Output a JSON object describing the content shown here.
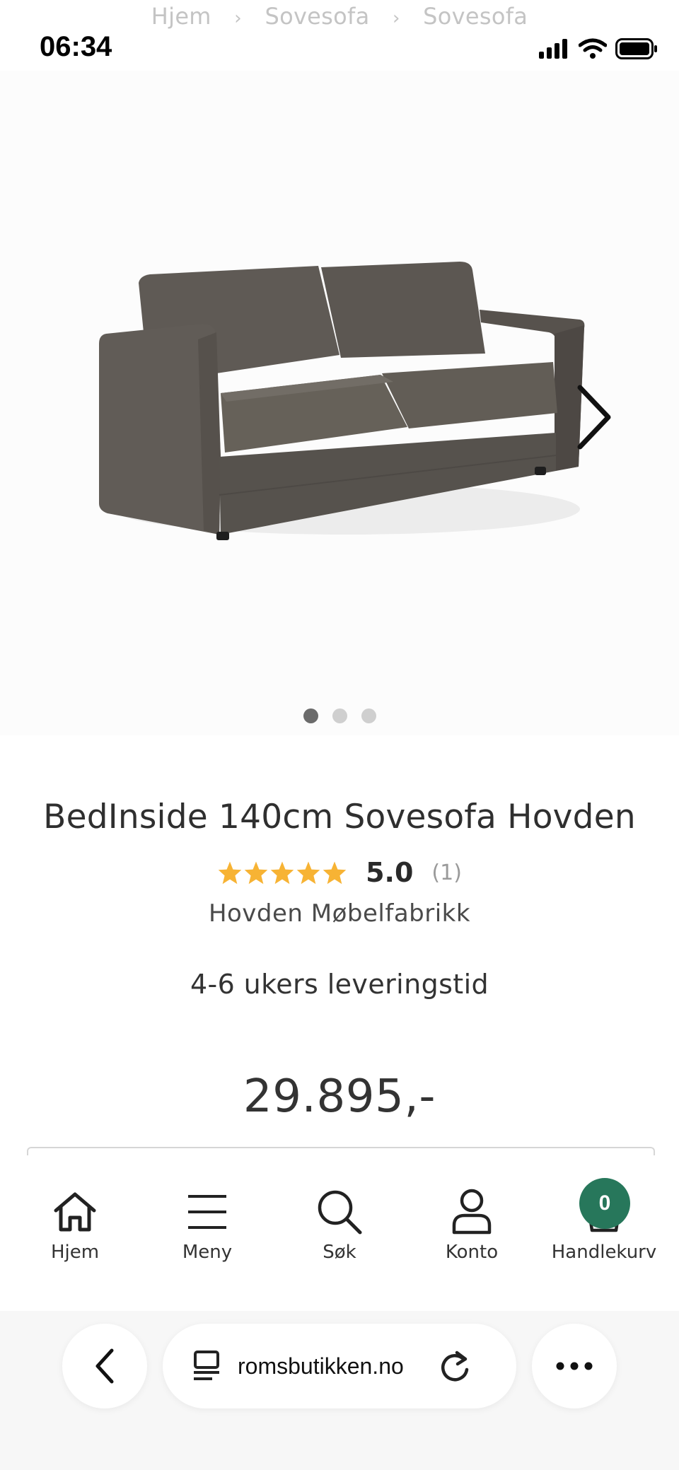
{
  "status_bar": {
    "time": "06:34",
    "icons": [
      "cellular-signal-icon",
      "wifi-icon",
      "battery-icon"
    ]
  },
  "breadcrumb": [
    "Hjem",
    "Sovesofa",
    "Sovesofa"
  ],
  "gallery": {
    "image_count": 3,
    "active_index": 0,
    "next_icon": "chevron-right-icon"
  },
  "product": {
    "title": "BedInside 140cm Sovesofa Hovden",
    "rating": "5.0",
    "rating_stars": 5,
    "review_count": "(1)",
    "brand": "Hovden Møbelfabrikk",
    "delivery": "4-6 ukers leveringstid",
    "price": "29.895,-"
  },
  "tabbar": {
    "items": [
      {
        "label": "Hjem",
        "icon": "home-icon"
      },
      {
        "label": "Meny",
        "icon": "menu-icon"
      },
      {
        "label": "Søk",
        "icon": "search-icon"
      },
      {
        "label": "Konto",
        "icon": "user-icon"
      },
      {
        "label": "Handlekurv",
        "icon": "cart-icon"
      }
    ],
    "cart_count": "0"
  },
  "browser": {
    "url": "romsbutikken.no"
  },
  "colors": {
    "accent_green": "#27775b",
    "star": "#f7b334"
  }
}
